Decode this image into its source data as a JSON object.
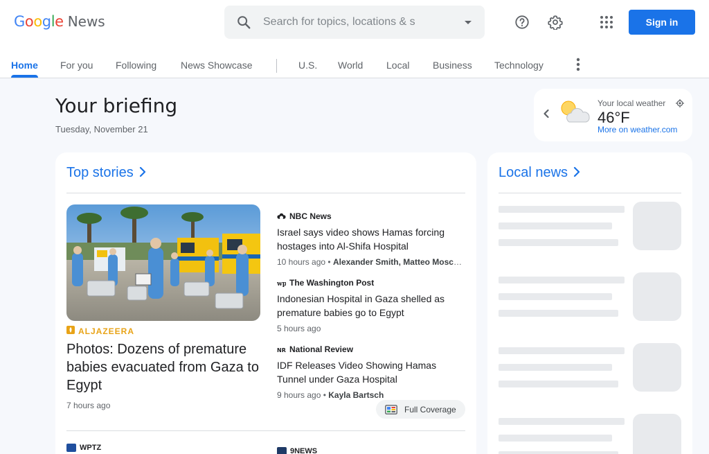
{
  "header": {
    "logo": {
      "g1": "G",
      "o1": "o",
      "o2": "o",
      "g2": "g",
      "l": "l",
      "e": "e",
      "product": "News"
    },
    "search": {
      "placeholder": "Search for topics, locations & s"
    },
    "signin_label": "Sign in",
    "icons": [
      "search-icon",
      "dropdown-arrow-icon",
      "help-icon",
      "settings-icon",
      "apps-icon"
    ]
  },
  "tabs": [
    {
      "label": "Home",
      "active": true
    },
    {
      "label": "For you"
    },
    {
      "label": "Following"
    },
    {
      "label": "News Showcase"
    },
    {
      "label": "U.S."
    },
    {
      "label": "World"
    },
    {
      "label": "Local"
    },
    {
      "label": "Business"
    },
    {
      "label": "Technology"
    }
  ],
  "briefing": {
    "title": "Your briefing",
    "date": "Tuesday, November 21"
  },
  "weather": {
    "label": "Your local weather",
    "temp": "46°F",
    "link": "More on weather.com"
  },
  "top_stories": {
    "heading": "Top stories",
    "hero": {
      "source": "ALJAZEERA",
      "title": "Photos: Dozens of premature babies evacuated from Gaza to Egypt",
      "time": "7 hours ago"
    },
    "stories": [
      {
        "source": "NBC News",
        "title": "Israel says video shows Hamas forcing hostages into Al-Shifa Hospital",
        "time": "10 hours ago",
        "authors": "Alexander Smith, Matteo Mosch..."
      },
      {
        "source": "The Washington Post",
        "title": "Indonesian Hospital in Gaza shelled as premature babies go to Egypt",
        "time": "5 hours ago",
        "authors": ""
      },
      {
        "source": "National Review",
        "title": "IDF Releases Video Showing Hamas Tunnel under Gaza Hospital",
        "time": "9 hours ago",
        "authors": "Kayla Bartsch"
      }
    ],
    "full_coverage": "Full Coverage",
    "next_sources": [
      "WPTZ",
      "9NEWS"
    ]
  },
  "local_news": {
    "heading": "Local news"
  },
  "colors": {
    "accent": "#1a73e8",
    "aljazeera": "#e8a317"
  }
}
